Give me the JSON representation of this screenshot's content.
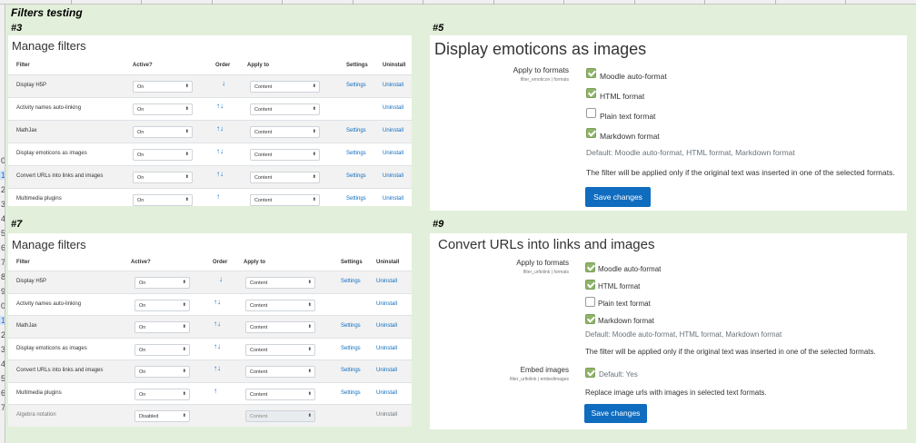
{
  "sheet": {
    "title": "Filters testing",
    "row_numbers": [
      "0",
      "1",
      "2",
      "3",
      "4",
      "5",
      "6",
      "7",
      "8",
      "9",
      "0",
      "1",
      "2",
      "3",
      "4",
      "5",
      "6",
      "7"
    ]
  },
  "sections": {
    "s3": "#3",
    "s5": "#5",
    "s7": "#7",
    "s9": "#9"
  },
  "manage_filters_a": {
    "title": "Manage filters",
    "headers": {
      "filter": "Filter",
      "active": "Active?",
      "order": "Order",
      "apply": "Apply to",
      "settings": "Settings",
      "uninstall": "Uninstall"
    },
    "rows": [
      {
        "name": "Display H5P",
        "active": "On",
        "order": "↓",
        "apply": "Content",
        "settings": "Settings",
        "uninstall": "Uninstall"
      },
      {
        "name": "Activity names auto-linking",
        "active": "On",
        "order": "↑↓",
        "apply": "Content",
        "settings": "",
        "uninstall": "Uninstall"
      },
      {
        "name": "MathJax",
        "active": "On",
        "order": "↑↓",
        "apply": "Content",
        "settings": "Settings",
        "uninstall": "Uninstall"
      },
      {
        "name": "Display emoticons as images",
        "active": "On",
        "order": "↑↓",
        "apply": "Content",
        "settings": "Settings",
        "uninstall": "Uninstall"
      },
      {
        "name": "Convert URLs into links and images",
        "active": "On",
        "order": "↑↓",
        "apply": "Content",
        "settings": "Settings",
        "uninstall": "Uninstall"
      },
      {
        "name": "Multimedia plugins",
        "active": "On",
        "order": "↑",
        "apply": "Content",
        "settings": "Settings",
        "uninstall": "Uninstall"
      }
    ]
  },
  "manage_filters_b": {
    "title": "Manage filters",
    "headers": {
      "filter": "Filter",
      "active": "Active?",
      "order": "Order",
      "apply": "Apply to",
      "settings": "Settings",
      "uninstall": "Uninstall"
    },
    "rows": [
      {
        "name": "Display H5P",
        "active": "On",
        "order": "↓",
        "apply": "Content",
        "settings": "Settings",
        "uninstall": "Uninstall"
      },
      {
        "name": "Activity names auto-linking",
        "active": "On",
        "order": "↑↓",
        "apply": "Content",
        "settings": "",
        "uninstall": "Uninstall"
      },
      {
        "name": "MathJax",
        "active": "On",
        "order": "↑↓",
        "apply": "Content",
        "settings": "Settings",
        "uninstall": "Uninstall"
      },
      {
        "name": "Display emoticons as images",
        "active": "On",
        "order": "↑↓",
        "apply": "Content",
        "settings": "Settings",
        "uninstall": "Uninstall"
      },
      {
        "name": "Convert URLs into links and images",
        "active": "On",
        "order": "↑↓",
        "apply": "Content",
        "settings": "Settings",
        "uninstall": "Uninstall"
      },
      {
        "name": "Multimedia plugins",
        "active": "On",
        "order": "↑",
        "apply": "Content",
        "settings": "Settings",
        "uninstall": "Uninstall"
      },
      {
        "name": "Algebra notation",
        "active": "Disabled",
        "order": "",
        "apply": "Content",
        "settings": "",
        "uninstall": "Uninstall"
      }
    ]
  },
  "emoticons": {
    "title": "Display emoticons as images",
    "apply_label": "Apply to formats",
    "apply_sub": "filter_emoticon | formats",
    "formats": [
      {
        "label": "Moodle auto-format",
        "checked": true
      },
      {
        "label": "HTML format",
        "checked": true
      },
      {
        "label": "Plain text format",
        "checked": false
      },
      {
        "label": "Markdown format",
        "checked": true
      }
    ],
    "default_text": "Default: Moodle auto-format, HTML format, Markdown format",
    "help_text": "The filter will be applied only if the original text was inserted in one of the selected formats.",
    "save_label": "Save changes"
  },
  "urltolink": {
    "title": "Convert URLs into links and images",
    "apply_label": "Apply to formats",
    "apply_sub": "filter_urltolink | formats",
    "formats": [
      {
        "label": "Moodle auto-format",
        "checked": true
      },
      {
        "label": "HTML format",
        "checked": true
      },
      {
        "label": "Plain text format",
        "checked": false
      },
      {
        "label": "Markdown format",
        "checked": true
      }
    ],
    "default_text": "Default: Moodle auto-format, HTML format, Markdown format",
    "help_text": "The filter will be applied only if the original text was inserted in one of the selected formats.",
    "embed_label": "Embed images",
    "embed_sub": "filter_urltolink | embedimages",
    "embed_default": "Default: Yes",
    "embed_help": "Replace image urls with images in selected text formats.",
    "save_label": "Save changes"
  },
  "colors": {
    "background": "#e2efda",
    "link": "#0f6cbf",
    "button": "#0f6cbf",
    "checkbox": "#8fb46b"
  }
}
